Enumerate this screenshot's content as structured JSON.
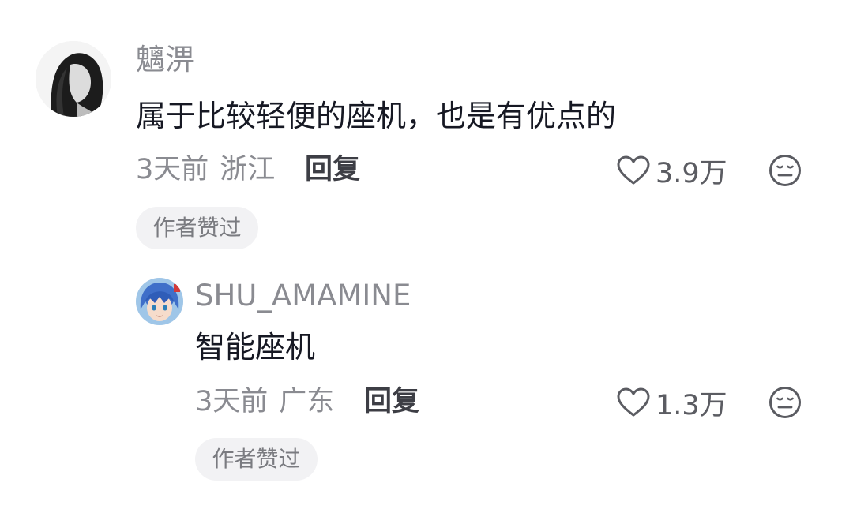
{
  "comments": [
    {
      "username": "魑淠",
      "avatar": "anime-girl-monochrome-avatar",
      "content": "属于比较轻便的座机，也是有优点的",
      "time": "3天前",
      "location": "浙江",
      "reply_label": "回复",
      "like_count": "3.9万",
      "badge": "作者赞过"
    }
  ],
  "replies": [
    {
      "username": "SHU_AMAMINE",
      "avatar": "anime-boy-blue-hair-avatar",
      "content": "智能座机",
      "time": "3天前",
      "location": "广东",
      "reply_label": "回复",
      "like_count": "1.3万",
      "badge": "作者赞过"
    }
  ],
  "icons": {
    "like": "heart-outline-icon",
    "dislike": "meh-face-icon"
  },
  "colors": {
    "text_primary": "#161823",
    "text_secondary": "#8a8b91",
    "badge_bg": "#f2f2f4"
  }
}
